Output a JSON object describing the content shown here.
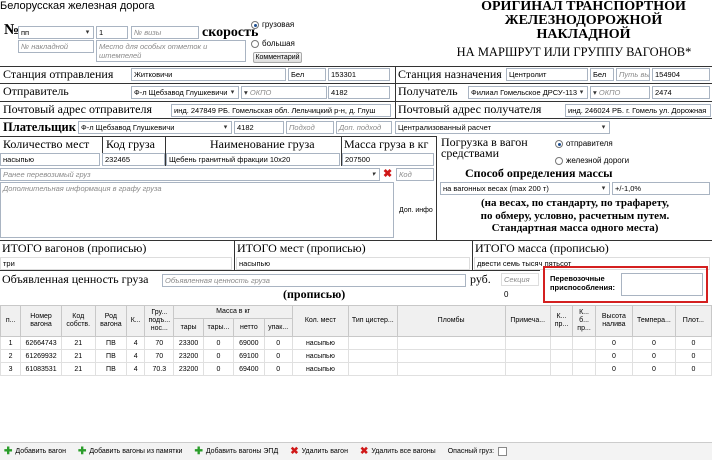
{
  "header": {
    "railway_name": "Белорусская железная дорога",
    "title_line1": "ОРИГИНАЛ ТРАНСПОРТНОЙ",
    "title_line2": "ЖЕЛЕЗНОДОРОЖНОЙ",
    "title_line3": "НАКЛАДНОЙ",
    "title_line4": "НА МАРШРУТ ИЛИ ГРУППУ ВАГОНОВ*",
    "number_label": "№",
    "number_value": "пп",
    "number_placeholder": "№ накладной",
    "count_value": "1",
    "visa_placeholder": "№ визы",
    "speed_label": "скорость",
    "notes_placeholder": "Место для особых отметок и штемпелей",
    "speed_options": [
      "грузовая",
      "большая"
    ],
    "comment_button": "Комментарий"
  },
  "departure": {
    "label": "Станция отправления",
    "station": "Житковичи",
    "country": "Бел",
    "code": "153301"
  },
  "destination": {
    "label": "Станция назначения",
    "station": "Центролит",
    "country": "Бел",
    "way_placeholder": "Путь выг",
    "code": "154904"
  },
  "sender": {
    "label": "Отправитель",
    "name": "Ф-л Щебзавод Глушкевичи",
    "okpo_placeholder": "ОКПО",
    "code": "4182"
  },
  "receiver": {
    "label": "Получатель",
    "name": "Филиал Гомельское ДРСУ-113",
    "okpo_placeholder": "ОКПО",
    "code": "2474"
  },
  "sender_address": {
    "label": "Почтовый адрес отправителя",
    "value": "инд. 247849  РБ. Гомельская обл. Лельчицкий р-н, д. Глуш"
  },
  "receiver_address": {
    "label": "Почтовый адрес получателя",
    "value": "инд. 246024 РБ. г. Гомель ул. Дорожная"
  },
  "payer": {
    "label": "Плательщик",
    "name": "Ф-л Щебзавод Глушкевичи",
    "code": "4182",
    "code_placeholder": "Подход",
    "subcode_placeholder": "Доп. подход",
    "payment": "Централизованный расчет"
  },
  "cargo_headers": {
    "places": "Количество мест",
    "code": "Код груза",
    "name": "Наименование груза",
    "mass": "Масса груза в кг"
  },
  "cargo": {
    "places": "насыпью",
    "code": "232465",
    "name": "Щебень гранитный фракции 10x20",
    "mass": "207500",
    "previous_placeholder": "Ранее перевозимый груз",
    "code_placeholder": "Код",
    "extra_placeholder": "Дополнительная информация в графу груза",
    "extra_button": "Доп. инфо"
  },
  "loading": {
    "label": "Погрузка в вагон средствами",
    "options": [
      "отправителя",
      "железной дороги"
    ]
  },
  "mass_method": {
    "label": "Способ определения массы",
    "value": "на вагонных весах (max 200 т)",
    "tolerance": "+/-1,0%",
    "note_line1": "(на весах, по стандарту, по трафарету,",
    "note_line2": "по обмеру, условно, расчетным путем.",
    "note_line3": "Стандартная масса одного места)"
  },
  "totals": {
    "wagons_label": "ИТОГО вагонов (прописью)",
    "wagons_value": "три",
    "places_label": "ИТОГО мест (прописью)",
    "places_value": "насыпью",
    "mass_label": "ИТОГО масса (прописью)",
    "mass_value": "двести семь тысяч пятьсот"
  },
  "declared": {
    "label": "Объявленная ценность груза",
    "placeholder": "Объявленная ценность груза",
    "currency": "руб.",
    "section_placeholder": "Секция",
    "section_value": "0",
    "spelled": "(прописью)",
    "devices_label_line1": "Перевозочные",
    "devices_label_line2": "приспособления:"
  },
  "wagon_table": {
    "headers": [
      "п...",
      "Номер вагона",
      "Код собств.",
      "Род вагона",
      "К...",
      "Гру... подъ... нос...",
      "тары",
      "тары...",
      "нетто",
      "упак...",
      "Кол. мест",
      "Тип цистер...",
      "Пломбы",
      "Примеча...",
      "К... пр...",
      "К... б... пр...",
      "Высота налива",
      "Темпера...",
      "Плот..."
    ],
    "mass_group": "Масса в кг",
    "rows": [
      [
        "1",
        "62664743",
        "21",
        "ПВ",
        "4",
        "70",
        "23300",
        "0",
        "69000",
        "0",
        "насыпью",
        "",
        "",
        "",
        "",
        "",
        "0",
        "0",
        "0"
      ],
      [
        "2",
        "61269932",
        "21",
        "ПВ",
        "4",
        "70",
        "23200",
        "0",
        "69100",
        "0",
        "насыпью",
        "",
        "",
        "",
        "",
        "",
        "0",
        "0",
        "0"
      ],
      [
        "3",
        "61083531",
        "21",
        "ПВ",
        "4",
        "70.3",
        "23200",
        "0",
        "69400",
        "0",
        "насыпью",
        "",
        "",
        "",
        "",
        "",
        "0",
        "0",
        "0"
      ]
    ]
  },
  "toolbar": {
    "add_wagon": "Добавить вагон",
    "add_from_memory": "Добавить вагоны из памятки",
    "add_epd": "Добавить вагоны ЭПД",
    "delete_wagon": "Удалить вагон",
    "delete_all": "Удалить все вагоны",
    "dangerous": "Опасный груз:"
  },
  "colors": {
    "highlight_border": "#d42020",
    "add_icon": "#2a9d2a",
    "delete_icon": "#d01818"
  },
  "icons": [
    "plus-icon",
    "delete-icon",
    "dropdown-arrow-icon",
    "radio-icon",
    "checkbox-icon"
  ]
}
